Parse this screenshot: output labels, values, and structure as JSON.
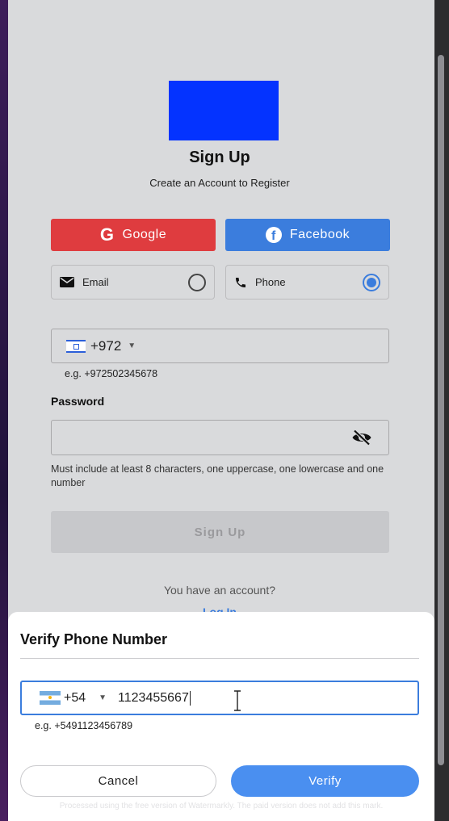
{
  "header": {
    "title": "Sign Up",
    "subtitle": "Create an Account to Register"
  },
  "social": {
    "google_label": "Google",
    "google_icon": "G",
    "facebook_label": "Facebook",
    "facebook_icon": "f"
  },
  "methods": {
    "email_label": "Email",
    "phone_label": "Phone",
    "selected": "phone"
  },
  "phone": {
    "code": "+972",
    "hint": "e.g. +972502345678"
  },
  "password": {
    "label": "Password",
    "value": "",
    "help": "Must include at least 8 characters, one uppercase, one lowercase and one number"
  },
  "signup_button": "Sign Up",
  "footer": {
    "have_account": "You have an account?",
    "login_link": "Log In"
  },
  "modal": {
    "title": "Verify Phone Number",
    "code": "+54",
    "number": "1123455667",
    "hint": "e.g. +5491123456789",
    "cancel_label": "Cancel",
    "verify_label": "Verify"
  },
  "watermark": "Processed using the free version of Watermarkly. The paid version does not add this mark.",
  "colors": {
    "google": "#df3c3f",
    "facebook": "#3b7ddd",
    "logo": "#0433ff",
    "accent": "#3b7ddd",
    "verify_button": "#4a8ff0",
    "disabled_button": "#c7c8cb"
  }
}
